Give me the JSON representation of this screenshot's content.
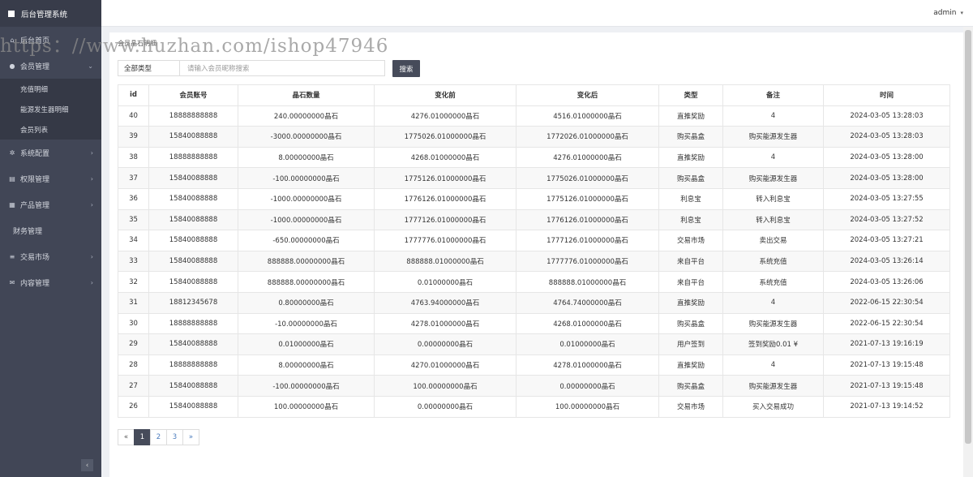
{
  "sidebar": {
    "title": "后台管理系统",
    "items": [
      {
        "label": "后台首页",
        "icon": "home-icon",
        "glyph": "⌂",
        "chevron": ""
      },
      {
        "label": "会员管理",
        "icon": "user-icon",
        "glyph": "●",
        "chevron": "⌄"
      },
      {
        "label": "系统配置",
        "icon": "cog-icon",
        "glyph": "✲",
        "chevron": "›"
      },
      {
        "label": "权限管理",
        "icon": "list-icon",
        "glyph": "▤",
        "chevron": "›"
      },
      {
        "label": "产品管理",
        "icon": "grid-icon",
        "glyph": "▦",
        "chevron": "›"
      },
      {
        "label": "财务管理",
        "icon": "",
        "glyph": "",
        "chevron": ""
      },
      {
        "label": "交易市场",
        "icon": "bars-icon",
        "glyph": "≡",
        "chevron": "›"
      },
      {
        "label": "内容管理",
        "icon": "mail-icon",
        "glyph": "✉",
        "chevron": "›"
      }
    ],
    "sub_items": [
      "充值明细",
      "能源发生器明细",
      "会员列表"
    ],
    "collapse_glyph": "‹"
  },
  "topbar": {
    "user": "admin",
    "caret": "▾"
  },
  "watermark": "https：//www.huzhan.com/ishop47946",
  "panel": {
    "title": "会员晶石明细",
    "filter_select": "全部类型",
    "search_placeholder": "请输入会员昵称搜索",
    "search_button": "搜索"
  },
  "table": {
    "columns": [
      "id",
      "会员账号",
      "晶石数量",
      "变化前",
      "变化后",
      "类型",
      "备注",
      "时间"
    ],
    "rows": [
      [
        "40",
        "18888888888",
        "240.00000000晶石",
        "4276.01000000晶石",
        "4516.01000000晶石",
        "直推奖励",
        "4",
        "2024-03-05 13:28:03"
      ],
      [
        "39",
        "15840088888",
        "-3000.00000000晶石",
        "1775026.01000000晶石",
        "1772026.01000000晶石",
        "购买晶盒",
        "购买能源发生器",
        "2024-03-05 13:28:03"
      ],
      [
        "38",
        "18888888888",
        "8.00000000晶石",
        "4268.01000000晶石",
        "4276.01000000晶石",
        "直推奖励",
        "4",
        "2024-03-05 13:28:00"
      ],
      [
        "37",
        "15840088888",
        "-100.00000000晶石",
        "1775126.01000000晶石",
        "1775026.01000000晶石",
        "购买晶盒",
        "购买能源发生器",
        "2024-03-05 13:28:00"
      ],
      [
        "36",
        "15840088888",
        "-1000.00000000晶石",
        "1776126.01000000晶石",
        "1775126.01000000晶石",
        "利息宝",
        "转入利息宝",
        "2024-03-05 13:27:55"
      ],
      [
        "35",
        "15840088888",
        "-1000.00000000晶石",
        "1777126.01000000晶石",
        "1776126.01000000晶石",
        "利息宝",
        "转入利息宝",
        "2024-03-05 13:27:52"
      ],
      [
        "34",
        "15840088888",
        "-650.00000000晶石",
        "1777776.01000000晶石",
        "1777126.01000000晶石",
        "交易市场",
        "卖出交易",
        "2024-03-05 13:27:21"
      ],
      [
        "33",
        "15840088888",
        "888888.00000000晶石",
        "888888.01000000晶石",
        "1777776.01000000晶石",
        "来自平台",
        "系统充值",
        "2024-03-05 13:26:14"
      ],
      [
        "32",
        "15840088888",
        "888888.00000000晶石",
        "0.01000000晶石",
        "888888.01000000晶石",
        "来自平台",
        "系统充值",
        "2024-03-05 13:26:06"
      ],
      [
        "31",
        "18812345678",
        "0.80000000晶石",
        "4763.94000000晶石",
        "4764.74000000晶石",
        "直推奖励",
        "4",
        "2022-06-15 22:30:54"
      ],
      [
        "30",
        "18888888888",
        "-10.00000000晶石",
        "4278.01000000晶石",
        "4268.01000000晶石",
        "购买晶盒",
        "购买能源发生器",
        "2022-06-15 22:30:54"
      ],
      [
        "29",
        "15840088888",
        "0.01000000晶石",
        "0.00000000晶石",
        "0.01000000晶石",
        "用户签到",
        "签到奖励0.01 ¥",
        "2021-07-13 19:16:19"
      ],
      [
        "28",
        "18888888888",
        "8.00000000晶石",
        "4270.01000000晶石",
        "4278.01000000晶石",
        "直推奖励",
        "4",
        "2021-07-13 19:15:48"
      ],
      [
        "27",
        "15840088888",
        "-100.00000000晶石",
        "100.00000000晶石",
        "0.00000000晶石",
        "购买晶盒",
        "购买能源发生器",
        "2021-07-13 19:15:48"
      ],
      [
        "26",
        "15840088888",
        "100.00000000晶石",
        "0.00000000晶石",
        "100.00000000晶石",
        "交易市场",
        "买入交易成功",
        "2021-07-13 19:14:52"
      ]
    ]
  },
  "pagination": {
    "prev": "«",
    "pages": [
      "1",
      "2",
      "3"
    ],
    "next": "»",
    "active": "1"
  },
  "colors": {
    "sidebar": "#414656",
    "accent": "#464b5a"
  }
}
